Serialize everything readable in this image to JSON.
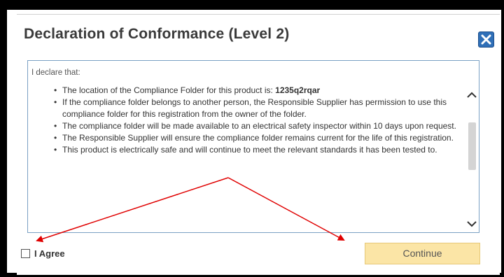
{
  "dialog": {
    "title": "Declaration of Conformance (Level 2)",
    "intro": "I declare that:",
    "statements": [
      {
        "before": "The location of the Compliance Folder for this product is: ",
        "bold": "1235q2rqar"
      },
      {
        "before": "If the compliance folder belongs to another person, the Responsible Supplier has permission to use this compliance folder for this registration from the owner of the folder."
      },
      {
        "before": "The compliance folder will be made available to an electrical safety inspector within 10 days upon request."
      },
      {
        "before": "The Responsible Supplier will ensure the compliance folder remains current for the life of this registration."
      },
      {
        "before": "This product is electrically safe and will continue to meet the relevant standards it has been tested to."
      }
    ],
    "agree_label": "I Agree",
    "continue_label": "Continue",
    "close_icon": "close-icon"
  },
  "colors": {
    "close_button": "#2f6fb7",
    "continue_button": "#fbe5a6",
    "annotation_arrow": "#e00000"
  }
}
